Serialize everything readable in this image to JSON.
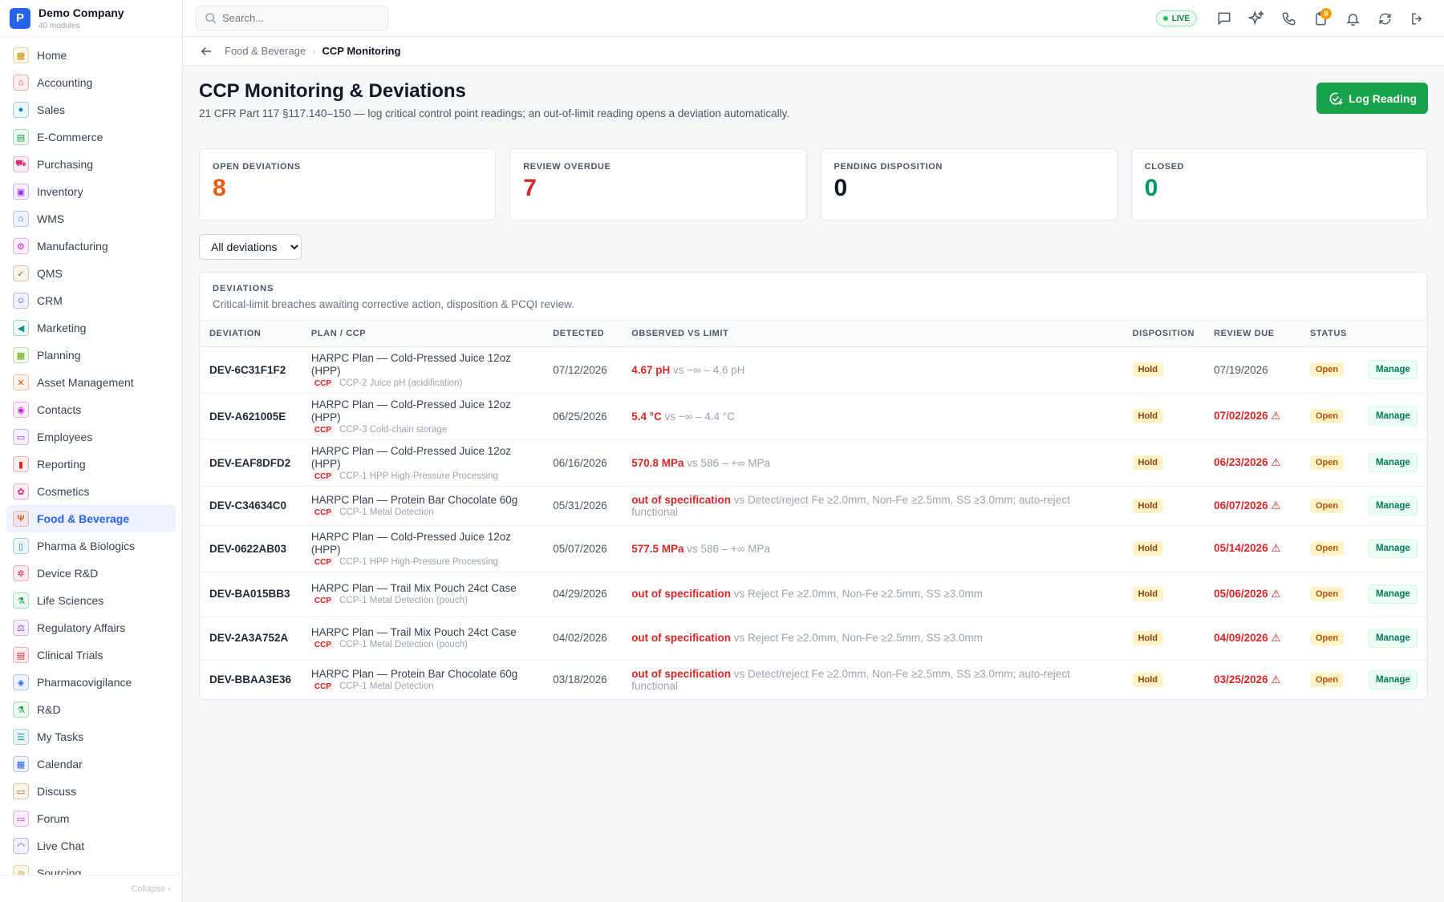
{
  "brand": {
    "name": "Demo Company",
    "sub": "40 modules",
    "logo": "P"
  },
  "sidebar": {
    "items": [
      {
        "label": "Home",
        "icon": "grid-icon",
        "glyph": "▦",
        "color": "#ca8a04"
      },
      {
        "label": "Accounting",
        "icon": "bank-icon",
        "glyph": "⌂",
        "color": "#dc2626"
      },
      {
        "label": "Sales",
        "icon": "user-icon",
        "glyph": "●",
        "color": "#0284c7"
      },
      {
        "label": "E-Commerce",
        "icon": "store-icon",
        "glyph": "▤",
        "color": "#16a34a"
      },
      {
        "label": "Purchasing",
        "icon": "cart-icon",
        "glyph": "⛟",
        "color": "#db2777"
      },
      {
        "label": "Inventory",
        "icon": "box-icon",
        "glyph": "▣",
        "color": "#9333ea"
      },
      {
        "label": "WMS",
        "icon": "warehouse-icon",
        "glyph": "⌂",
        "color": "#2563eb"
      },
      {
        "label": "Manufacturing",
        "icon": "factory-icon",
        "glyph": "⚙",
        "color": "#c026d3"
      },
      {
        "label": "QMS",
        "icon": "badge-check-icon",
        "glyph": "✓",
        "color": "#a16207"
      },
      {
        "label": "CRM",
        "icon": "users-icon",
        "glyph": "☺",
        "color": "#4f46e5"
      },
      {
        "label": "Marketing",
        "icon": "megaphone-icon",
        "glyph": "◀",
        "color": "#0d9488"
      },
      {
        "label": "Planning",
        "icon": "calendar-icon",
        "glyph": "▦",
        "color": "#65a30d"
      },
      {
        "label": "Asset Management",
        "icon": "wrench-icon",
        "glyph": "✕",
        "color": "#ea580c"
      },
      {
        "label": "Contacts",
        "icon": "contact-icon",
        "glyph": "◉",
        "color": "#c026d3"
      },
      {
        "label": "Employees",
        "icon": "id-card-icon",
        "glyph": "▭",
        "color": "#9333ea"
      },
      {
        "label": "Reporting",
        "icon": "bar-chart-icon",
        "glyph": "▮",
        "color": "#dc2626"
      },
      {
        "label": "Cosmetics",
        "icon": "flower-icon",
        "glyph": "✿",
        "color": "#db2777"
      },
      {
        "label": "Food & Beverage",
        "icon": "utensils-icon",
        "glyph": "Ψ",
        "color": "#ea580c"
      },
      {
        "label": "Pharma & Biologics",
        "icon": "pill-icon",
        "glyph": "▯",
        "color": "#0891b2"
      },
      {
        "label": "Device R&D",
        "icon": "cpu-icon",
        "glyph": "✲",
        "color": "#e11d48"
      },
      {
        "label": "Life Sciences",
        "icon": "flask-icon",
        "glyph": "⚗",
        "color": "#16a34a"
      },
      {
        "label": "Regulatory Affairs",
        "icon": "scale-icon",
        "glyph": "⚖",
        "color": "#9333ea"
      },
      {
        "label": "Clinical Trials",
        "icon": "clipboard-icon",
        "glyph": "▤",
        "color": "#dc2626"
      },
      {
        "label": "Pharmacovigilance",
        "icon": "shield-icon",
        "glyph": "◈",
        "color": "#2563eb"
      },
      {
        "label": "R&D",
        "icon": "beaker-icon",
        "glyph": "⚗",
        "color": "#16a34a"
      },
      {
        "label": "My Tasks",
        "icon": "checklist-icon",
        "glyph": "☰",
        "color": "#0891b2"
      },
      {
        "label": "Calendar",
        "icon": "calendar-icon",
        "glyph": "▦",
        "color": "#2563eb"
      },
      {
        "label": "Discuss",
        "icon": "chat-icon",
        "glyph": "▭",
        "color": "#a16207"
      },
      {
        "label": "Forum",
        "icon": "forum-icon",
        "glyph": "▭",
        "color": "#c026d3"
      },
      {
        "label": "Live Chat",
        "icon": "headset-icon",
        "glyph": "◠",
        "color": "#4f46e5"
      },
      {
        "label": "Sourcing",
        "icon": "globe-icon",
        "glyph": "◎",
        "color": "#ca8a04"
      }
    ],
    "active_index": 17,
    "collapse_label": "Collapse"
  },
  "search": {
    "placeholder": "Search..."
  },
  "topbar": {
    "live_label": "LIVE",
    "notif_count": "9"
  },
  "breadcrumb": {
    "parent": "Food & Beverage",
    "current": "CCP Monitoring"
  },
  "page": {
    "title": "CCP Monitoring & Deviations",
    "subtitle": "21 CFR Part 117 §117.140–150 — log critical control point readings; an out-of-limit reading opens a deviation automatically.",
    "log_button": "Log Reading"
  },
  "stats": [
    {
      "label": "OPEN DEVIATIONS",
      "value": "8",
      "color": "#ea580c"
    },
    {
      "label": "REVIEW OVERDUE",
      "value": "7",
      "color": "#dc2626"
    },
    {
      "label": "PENDING DISPOSITION",
      "value": "0",
      "color": "#111827"
    },
    {
      "label": "CLOSED",
      "value": "0",
      "color": "#059669"
    }
  ],
  "filter": {
    "selected": "All deviations"
  },
  "deviations": {
    "title": "DEVIATIONS",
    "subtitle": "Critical-limit breaches awaiting corrective action, disposition & PCQI review.",
    "columns": [
      "DEVIATION",
      "PLAN / CCP",
      "DETECTED",
      "OBSERVED VS LIMIT",
      "DISPOSITION",
      "REVIEW DUE",
      "STATUS",
      ""
    ],
    "ccp_tag": "CCP",
    "manage_label": "Manage",
    "rows": [
      {
        "id": "DEV-6C31F1F2",
        "plan": "HARPC Plan — Cold-Pressed Juice 12oz (HPP)",
        "ccp": "CCP-2 Juice pH (acidification)",
        "detected": "07/12/2026",
        "observed": "4.67 pH",
        "limit": "vs −∞ – 4.6 pH",
        "disposition": "Hold",
        "due": "07/19/2026",
        "overdue": false,
        "status": "Open"
      },
      {
        "id": "DEV-A621005E",
        "plan": "HARPC Plan — Cold-Pressed Juice 12oz (HPP)",
        "ccp": "CCP-3 Cold-chain storage",
        "detected": "06/25/2026",
        "observed": "5.4 °C",
        "limit": "vs −∞ – 4.4 °C",
        "disposition": "Hold",
        "due": "07/02/2026 ⚠",
        "overdue": true,
        "status": "Open"
      },
      {
        "id": "DEV-EAF8DFD2",
        "plan": "HARPC Plan — Cold-Pressed Juice 12oz (HPP)",
        "ccp": "CCP-1 HPP High-Pressure Processing",
        "detected": "06/16/2026",
        "observed": "570.8 MPa",
        "limit": "vs 586 – +∞ MPa",
        "disposition": "Hold",
        "due": "06/23/2026 ⚠",
        "overdue": true,
        "status": "Open"
      },
      {
        "id": "DEV-C34634C0",
        "plan": "HARPC Plan — Protein Bar Chocolate 60g",
        "ccp": "CCP-1 Metal Detection",
        "detected": "05/31/2026",
        "observed": "out of specification",
        "limit": "vs Detect/reject Fe ≥2.0mm, Non-Fe ≥2.5mm, SS ≥3.0mm; auto-reject functional",
        "disposition": "Hold",
        "due": "06/07/2026 ⚠",
        "overdue": true,
        "status": "Open"
      },
      {
        "id": "DEV-0622AB03",
        "plan": "HARPC Plan — Cold-Pressed Juice 12oz (HPP)",
        "ccp": "CCP-1 HPP High-Pressure Processing",
        "detected": "05/07/2026",
        "observed": "577.5 MPa",
        "limit": "vs 586 – +∞ MPa",
        "disposition": "Hold",
        "due": "05/14/2026 ⚠",
        "overdue": true,
        "status": "Open"
      },
      {
        "id": "DEV-BA015BB3",
        "plan": "HARPC Plan — Trail Mix Pouch 24ct Case",
        "ccp": "CCP-1 Metal Detection (pouch)",
        "detected": "04/29/2026",
        "observed": "out of specification",
        "limit": "vs Reject Fe ≥2.0mm, Non-Fe ≥2.5mm, SS ≥3.0mm",
        "disposition": "Hold",
        "due": "05/06/2026 ⚠",
        "overdue": true,
        "status": "Open"
      },
      {
        "id": "DEV-2A3A752A",
        "plan": "HARPC Plan — Trail Mix Pouch 24ct Case",
        "ccp": "CCP-1 Metal Detection (pouch)",
        "detected": "04/02/2026",
        "observed": "out of specification",
        "limit": "vs Reject Fe ≥2.0mm, Non-Fe ≥2.5mm, SS ≥3.0mm",
        "disposition": "Hold",
        "due": "04/09/2026 ⚠",
        "overdue": true,
        "status": "Open"
      },
      {
        "id": "DEV-BBAA3E36",
        "plan": "HARPC Plan — Protein Bar Chocolate 60g",
        "ccp": "CCP-1 Metal Detection",
        "detected": "03/18/2026",
        "observed": "out of specification",
        "limit": "vs Detect/reject Fe ≥2.0mm, Non-Fe ≥2.5mm, SS ≥3.0mm; auto-reject functional",
        "disposition": "Hold",
        "due": "03/25/2026 ⚠",
        "overdue": true,
        "status": "Open"
      }
    ]
  }
}
